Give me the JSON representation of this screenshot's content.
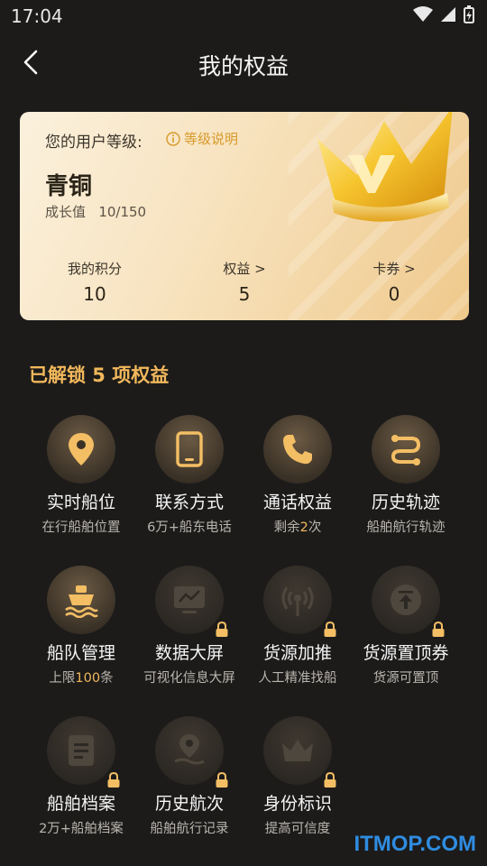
{
  "status": {
    "time": "17:04"
  },
  "header": {
    "title": "我的权益"
  },
  "card": {
    "level_label": "您的用户等级:",
    "level_explain": "等级说明",
    "level_name": "青铜",
    "growth_label": "成长值",
    "growth_value": "10/150",
    "stats": [
      {
        "label": "我的积分",
        "value": "10"
      },
      {
        "label": "权益 >",
        "value": "5"
      },
      {
        "label": "卡券 >",
        "value": "0"
      }
    ]
  },
  "section_title": "已解锁 5 项权益",
  "benefits": [
    {
      "name": "实时船位",
      "desc": "在行船舶位置",
      "icon": "location-icon",
      "locked": false
    },
    {
      "name": "联系方式",
      "desc": "6万+船东电话",
      "icon": "tablet-icon",
      "locked": false
    },
    {
      "name": "通话权益",
      "desc_pre": "剩余",
      "desc_hl": "2",
      "desc_post": "次",
      "icon": "phone-icon",
      "locked": false
    },
    {
      "name": "历史轨迹",
      "desc": "船舶航行轨迹",
      "icon": "route-icon",
      "locked": false
    },
    {
      "name": "船队管理",
      "desc_pre": "上限",
      "desc_hl": "100",
      "desc_post": "条",
      "icon": "ship-icon",
      "locked": false
    },
    {
      "name": "数据大屏",
      "desc": "可视化信息大屏",
      "icon": "monitor-icon",
      "locked": true
    },
    {
      "name": "货源加推",
      "desc": "人工精准找船",
      "icon": "broadcast-icon",
      "locked": true
    },
    {
      "name": "货源置顶券",
      "desc": "货源可置顶",
      "icon": "pin-top-icon",
      "locked": true
    },
    {
      "name": "船舶档案",
      "desc": "2万+船舶档案",
      "icon": "archive-icon",
      "locked": true
    },
    {
      "name": "历史航次",
      "desc": "船舶航行记录",
      "icon": "voyage-icon",
      "locked": true
    },
    {
      "name": "身份标识",
      "desc": "提高可信度",
      "icon": "crown-badge-icon",
      "locked": true
    }
  ],
  "colors": {
    "accent": "#f2b85b",
    "background": "#1c1b1a",
    "card_light": "#fbf1dd",
    "card_dark": "#efc98c"
  },
  "watermark": "ITMOP.COM"
}
